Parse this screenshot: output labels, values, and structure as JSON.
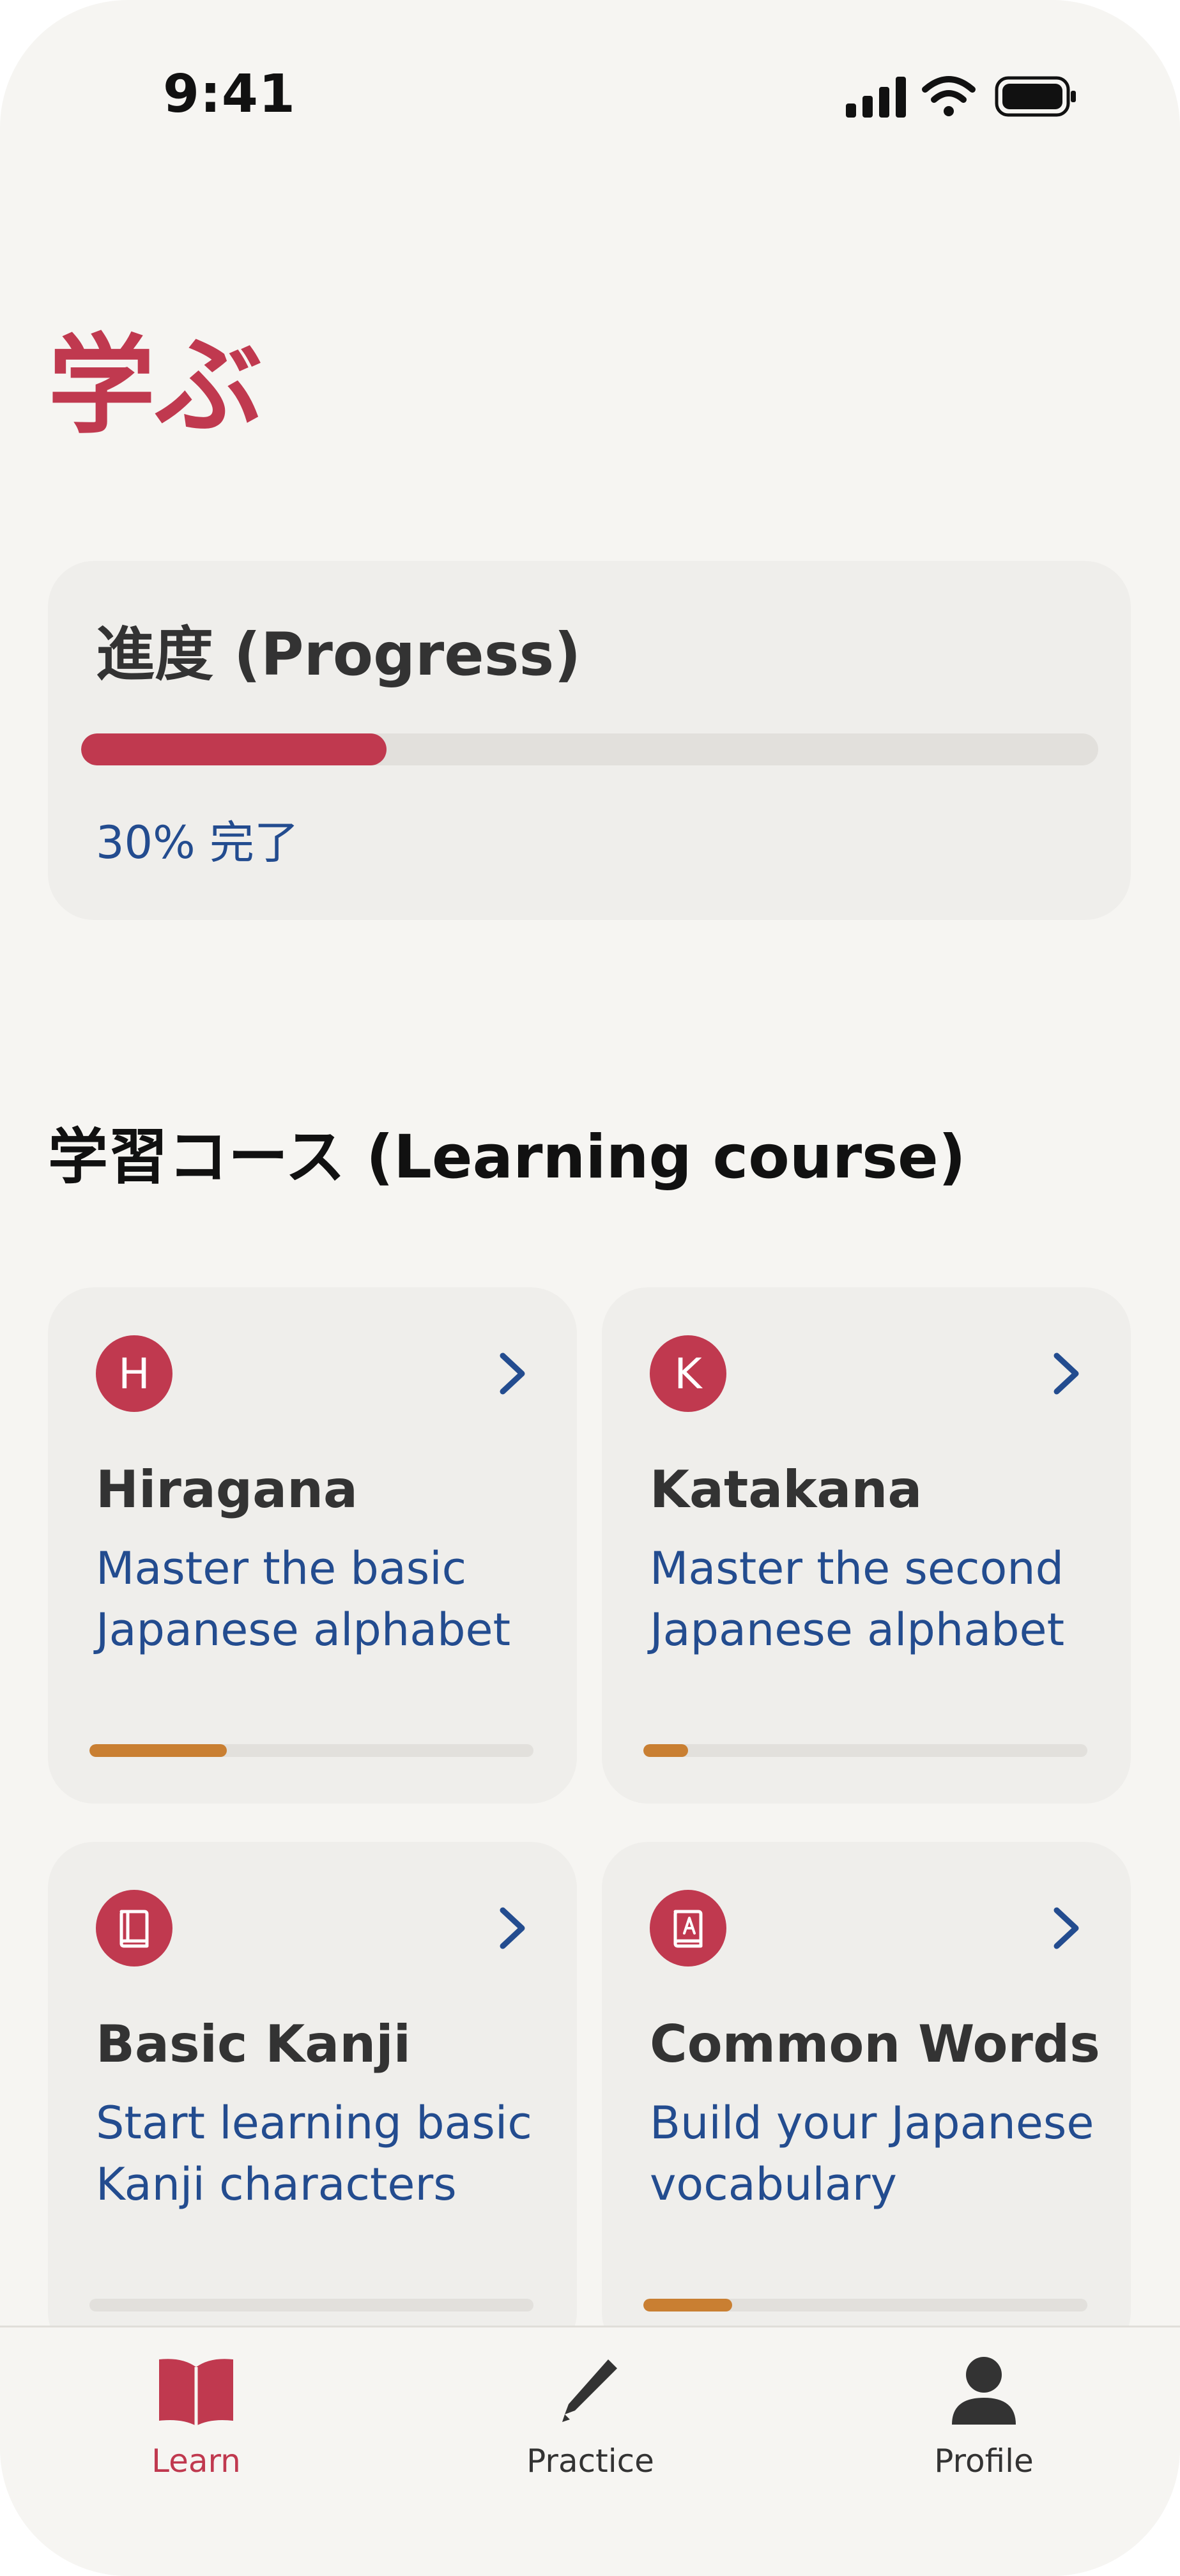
{
  "status_bar": {
    "time": "9:41"
  },
  "header": {
    "title": "学ぶ"
  },
  "progress": {
    "title": "進度 (Progress)",
    "percent": 30,
    "label": "30% 完了"
  },
  "section": {
    "title": "学習コース (Learning course)"
  },
  "courses": [
    {
      "badge": "H",
      "icon": "letter-badge",
      "name": "Hiragana",
      "description": "Master the basic Japanese alphabet",
      "progress": 0.31
    },
    {
      "badge": "K",
      "icon": "letter-badge",
      "name": "Katakana",
      "description": "Master the second Japanese alphabet",
      "progress": 0.1
    },
    {
      "badge": "",
      "icon": "book-icon",
      "name": "Basic Kanji",
      "description": "Start learning basic Kanji characters",
      "progress": 0.0
    },
    {
      "badge": "",
      "icon": "dictionary-icon",
      "name": "Common Words",
      "description": "Build your Japanese vocabulary",
      "progress": 0.2
    }
  ],
  "tab_bar": {
    "tabs": [
      {
        "label": "Learn",
        "icon": "open-book-icon",
        "active": true
      },
      {
        "label": "Practice",
        "icon": "pencil-icon",
        "active": false
      },
      {
        "label": "Profile",
        "icon": "person-icon",
        "active": false
      }
    ]
  },
  "colors": {
    "accent": "#c0394f",
    "link": "#234c8f",
    "course_progress": "#c97f32",
    "background": "#f6f5f2",
    "card": "#efeeeb"
  }
}
